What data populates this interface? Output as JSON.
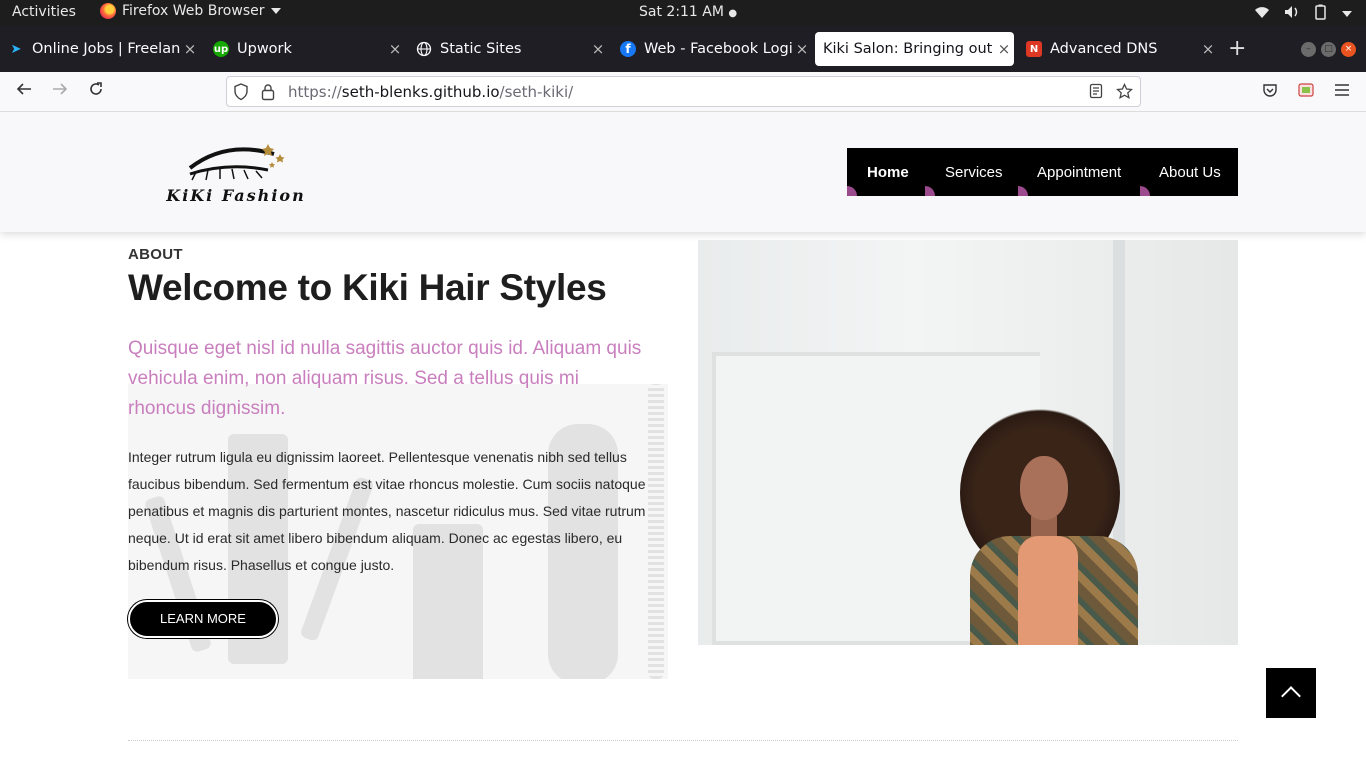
{
  "system_bar": {
    "activities": "Activities",
    "app_name": "Firefox Web Browser",
    "clock": "Sat  2:11 AM"
  },
  "tabs": [
    {
      "title": "Online Jobs | Freelanc",
      "icon": "freelancer-icon",
      "active": false
    },
    {
      "title": "Upwork",
      "icon": "upwork-icon",
      "active": false
    },
    {
      "title": "Static Sites",
      "icon": "globe-icon",
      "active": false
    },
    {
      "title": "Web - Facebook Login",
      "icon": "facebook-icon",
      "active": false
    },
    {
      "title": "Kiki Salon: Bringing out th",
      "icon": "none",
      "active": true
    },
    {
      "title": "Advanced DNS",
      "icon": "namecheap-icon",
      "active": false
    }
  ],
  "address_bar": {
    "protocol": "https://",
    "host": "seth-blenks.github.io",
    "path": "/seth-kiki/"
  },
  "site": {
    "logo_text": "KiKi Fashion",
    "nav": [
      "Home",
      "Services",
      "Appointment",
      "About Us"
    ],
    "active_nav": "Home",
    "section_label": "ABOUT",
    "headline": "Welcome to Kiki Hair Styles",
    "lead": "Quisque eget nisl id nulla sagittis auctor quis id. Aliquam quis vehicula enim, non aliquam risus. Sed a tellus quis mi rhoncus dignissim.",
    "body": "Integer rutrum ligula eu dignissim laoreet. Pellentesque venenatis nibh sed tellus faucibus bibendum. Sed fermentum est vitae rhoncus molestie. Cum sociis natoque penatibus et magnis dis parturient montes, nascetur ridiculus mus. Sed vitae rutrum neque. Ut id erat sit amet libero bibendum aliquam. Donec ac egestas libero, eu bibendum risus. Phasellus et congue justo.",
    "button": "LEARN MORE"
  },
  "colors": {
    "accent_pink": "#c97fbe",
    "nav_bg": "#000000",
    "nav_dot": "#9b4a8e"
  }
}
